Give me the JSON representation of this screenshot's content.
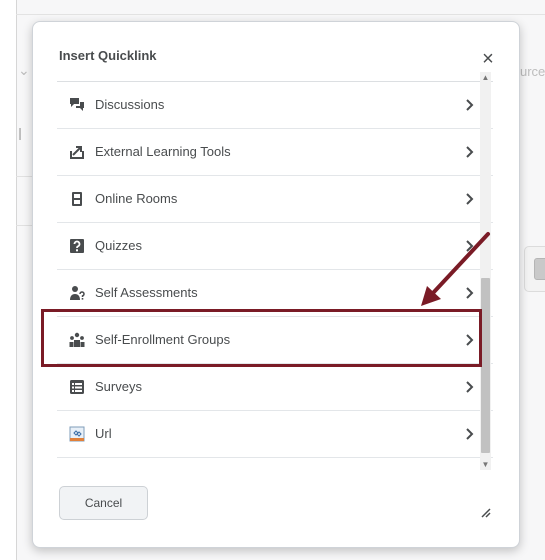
{
  "background": {
    "text_top_right": "urce"
  },
  "dialog": {
    "title": "Insert Quicklink",
    "close_glyph": "×",
    "items": [
      {
        "label": "Discussions",
        "icon": "discussions-icon"
      },
      {
        "label": "External Learning Tools",
        "icon": "external-tools-icon"
      },
      {
        "label": "Online Rooms",
        "icon": "online-rooms-icon"
      },
      {
        "label": "Quizzes",
        "icon": "quizzes-icon"
      },
      {
        "label": "Self Assessments",
        "icon": "self-assessments-icon"
      },
      {
        "label": "Self-Enrollment Groups",
        "icon": "self-enrollment-groups-icon",
        "highlighted": true
      },
      {
        "label": "Surveys",
        "icon": "surveys-icon"
      },
      {
        "label": "Url",
        "icon": "url-icon"
      }
    ],
    "cancel_label": "Cancel"
  },
  "colors": {
    "annotation": "#7a1b26",
    "text": "#494c4e",
    "icon": "#494c4e"
  }
}
